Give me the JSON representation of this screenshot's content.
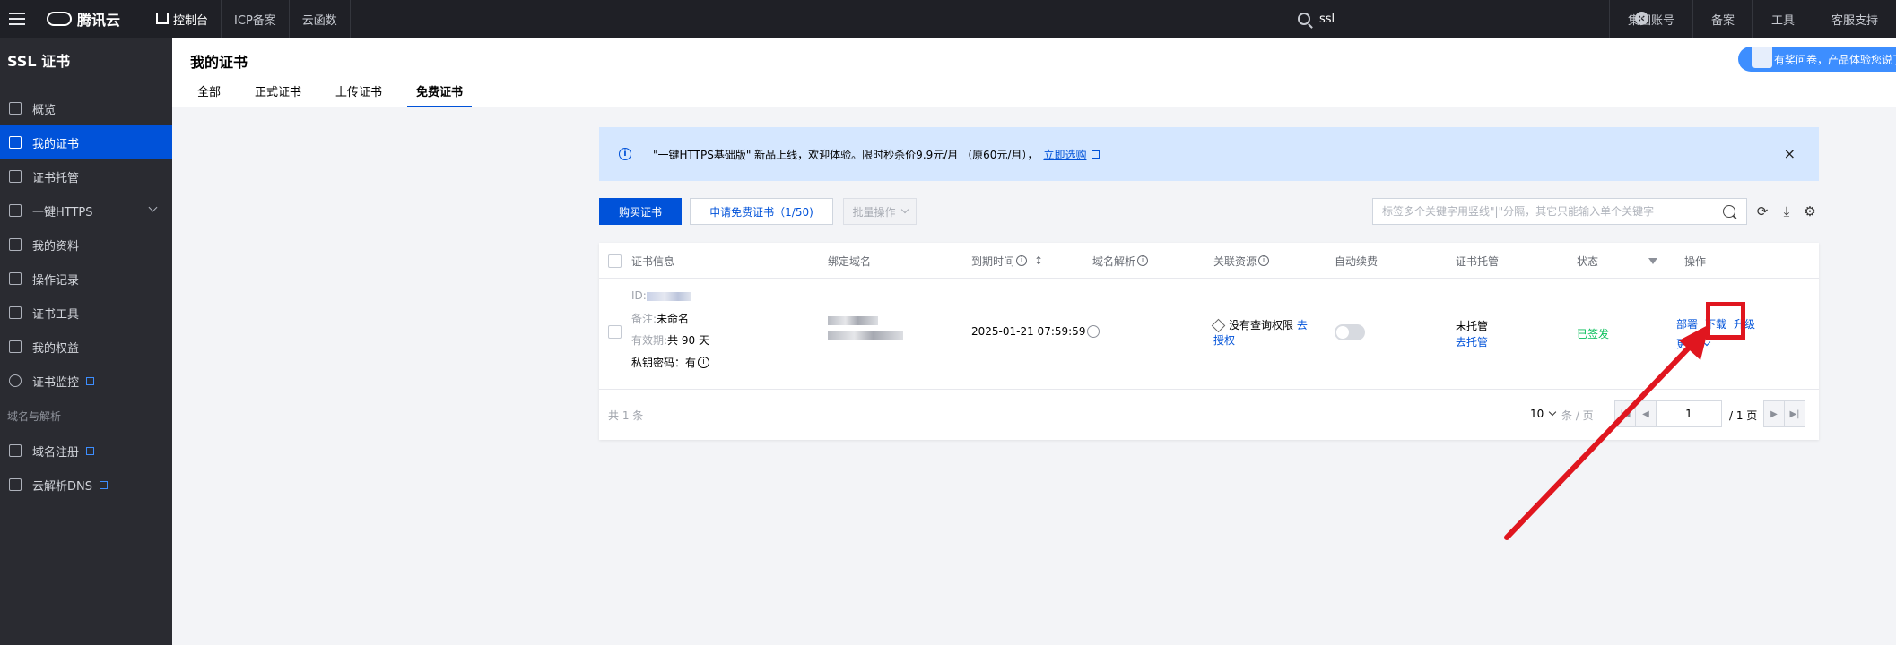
{
  "topbar": {
    "logo": "腾讯云",
    "nav": [
      "控制台",
      "ICP备案",
      "云函数"
    ],
    "search_value": "ssl",
    "right": [
      "集团账号",
      "备案",
      "工具",
      "客服支持"
    ]
  },
  "sidebar": {
    "product_title": "SSL 证书",
    "items": [
      "概览",
      "我的证书",
      "证书托管",
      "一键HTTPS",
      "我的资料",
      "操作记录",
      "证书工具",
      "我的权益",
      "证书监控"
    ],
    "group_label": "域名与解析",
    "group_items": [
      "域名注册",
      "云解析DNS"
    ]
  },
  "header": {
    "title": "我的证书",
    "tabs": [
      "全部",
      "正式证书",
      "上传证书",
      "免费证书"
    ],
    "survey": "有奖问卷，产品体验您说了算"
  },
  "notice": {
    "text": "\"一键HTTPS基础版\" 新品上线，欢迎体验。限时秒杀价9.9元/月 （原60元/月），",
    "link": "立即选购",
    "close": "×"
  },
  "toolbar": {
    "buy": "购买证书",
    "apply_free": "申请免费证书（1/50)",
    "batch": "批量操作",
    "search_placeholder": "标签多个关键字用竖线\"|\"分隔，其它只能输入单个关键字"
  },
  "table": {
    "headers": [
      "证书信息",
      "绑定域名",
      "到期时间",
      "域名解析",
      "关联资源",
      "自动续费",
      "证书托管",
      "状态",
      "操作"
    ],
    "row": {
      "id_label": "ID:",
      "remark_label": "备注:",
      "remark_value": "未命名",
      "validity_label": "有效期:",
      "validity_value": "共 90 天",
      "private_key": "私钥密码：有",
      "expire": "2025-01-21 07:59:59",
      "resource_text": "没有查询权限",
      "resource_link_1": "去",
      "resource_link_2": "授权",
      "hosting": "未托管",
      "hosting_link": "去托管",
      "status": "已签发",
      "actions": [
        "部署",
        "下载",
        "升级"
      ],
      "more": "更多"
    },
    "total": "共 1 条",
    "page_size": "10",
    "per_page": "条 / 页",
    "page": "1",
    "page_total": "/ 1 页"
  },
  "colors": {
    "accent": "#0052d9",
    "success": "#0abf5b",
    "highlight": "#e0161f"
  }
}
